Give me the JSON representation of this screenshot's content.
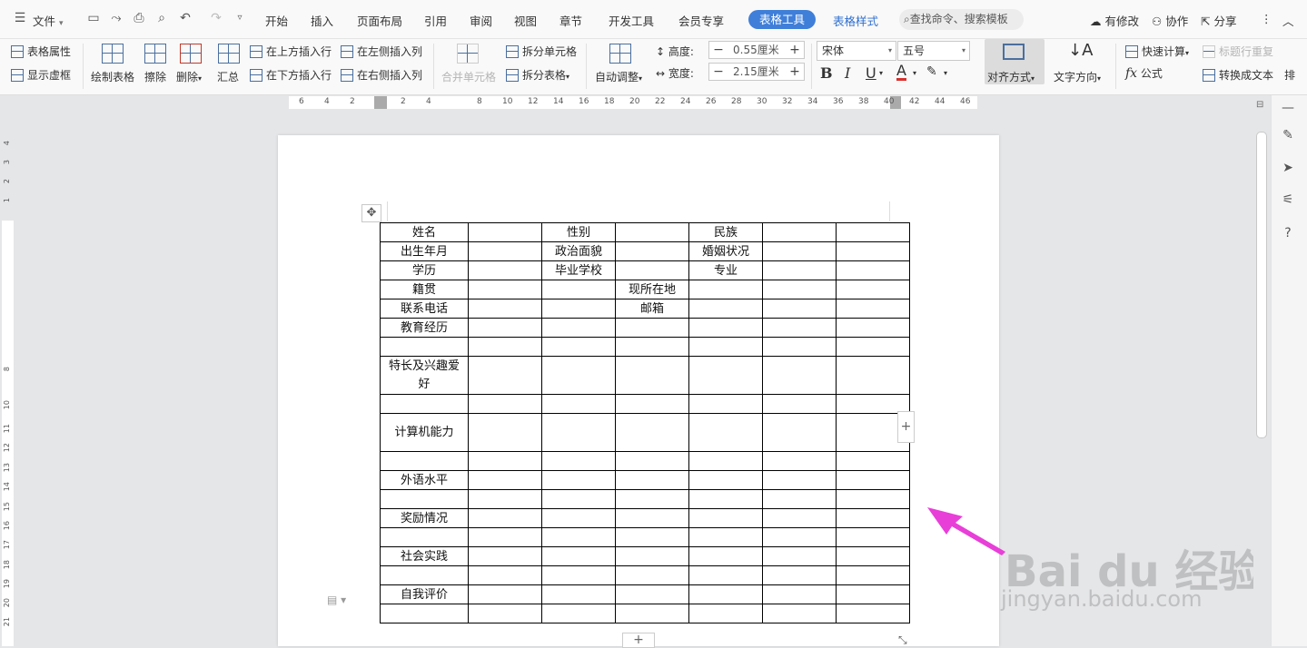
{
  "menubar": {
    "file_label": "文件",
    "tabs": [
      "开始",
      "插入",
      "页面布局",
      "引用",
      "审阅",
      "视图",
      "章节",
      "开发工具",
      "会员专享"
    ],
    "table_tools": "表格工具",
    "table_style": "表格样式",
    "search_placeholder": "查找命令、搜索模板",
    "modified": "有修改",
    "collaborate": "协作",
    "share": "分享"
  },
  "ribbon": {
    "table_props": "表格属性",
    "show_grid": "显示虚框",
    "draw_table": "绘制表格",
    "erase": "擦除",
    "delete": "删除",
    "summary": "汇总",
    "insert_above": "在上方插入行",
    "insert_below": "在下方插入行",
    "insert_left": "在左侧插入列",
    "insert_right": "在右侧插入列",
    "merge_cells": "合并单元格",
    "split_cells": "拆分单元格",
    "split_table": "拆分表格",
    "auto_adjust": "自动调整",
    "height_label": "高度:",
    "height_value": "0.55厘米",
    "width_label": "宽度:",
    "width_value": "2.15厘米",
    "font_name": "宋体",
    "font_size": "五号",
    "align": "对齐方式",
    "text_dir": "文字方向",
    "quick_calc": "快速计算",
    "repeat_header": "标题行重复",
    "formula": "公式",
    "convert_text": "转换成文本",
    "sort": "排"
  },
  "ruler": {
    "h_ticks": [
      "6",
      "4",
      "2",
      "2",
      "4",
      "8",
      "10",
      "12",
      "14",
      "16",
      "18",
      "20",
      "22",
      "24",
      "26",
      "28",
      "30",
      "32",
      "34",
      "36",
      "38",
      "40",
      "42",
      "44",
      "46"
    ],
    "v_ticks": [
      "4",
      "3",
      "2",
      "1",
      "8",
      "10",
      "11",
      "12",
      "13",
      "14",
      "15",
      "16",
      "17",
      "18",
      "19",
      "20",
      "21"
    ]
  },
  "table": {
    "rows": [
      [
        "姓名",
        "",
        "性别",
        "",
        "民族",
        "",
        ""
      ],
      [
        "出生年月",
        "",
        "政治面貌",
        "",
        "婚姻状况",
        "",
        ""
      ],
      [
        "学历",
        "",
        "毕业学校",
        "",
        "专业",
        "",
        ""
      ],
      [
        "籍贯",
        "",
        "",
        "现所在地",
        "",
        "",
        ""
      ],
      [
        "联系电话",
        "",
        "",
        "邮箱",
        "",
        "",
        ""
      ],
      [
        "教育经历",
        "",
        "",
        "",
        "",
        "",
        ""
      ],
      [
        "",
        "",
        "",
        "",
        "",
        "",
        ""
      ],
      [
        "特长及兴趣爱好",
        "",
        "",
        "",
        "",
        "",
        ""
      ],
      [
        "",
        "",
        "",
        "",
        "",
        "",
        ""
      ],
      [
        "计算机能力",
        "",
        "",
        "",
        "",
        "",
        ""
      ],
      [
        "",
        "",
        "",
        "",
        "",
        "",
        ""
      ],
      [
        "外语水平",
        "",
        "",
        "",
        "",
        "",
        ""
      ],
      [
        "",
        "",
        "",
        "",
        "",
        "",
        ""
      ],
      [
        "奖励情况",
        "",
        "",
        "",
        "",
        "",
        ""
      ],
      [
        "",
        "",
        "",
        "",
        "",
        "",
        ""
      ],
      [
        "社会实践",
        "",
        "",
        "",
        "",
        "",
        ""
      ],
      [
        "",
        "",
        "",
        "",
        "",
        "",
        ""
      ],
      [
        "自我评价",
        "",
        "",
        "",
        "",
        "",
        ""
      ],
      [
        "",
        "",
        "",
        "",
        "",
        "",
        ""
      ]
    ],
    "tall_rows": [
      7,
      9
    ]
  },
  "watermark": {
    "logo": "Bai du 经验",
    "url": "jingyan.baidu.com"
  },
  "colors": {
    "accent": "#3f7fd9",
    "arrow": "#e83fd8"
  }
}
